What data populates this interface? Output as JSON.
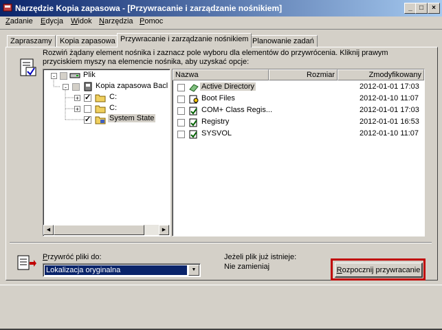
{
  "window": {
    "title": "Narzędzie Kopia zapasowa - [Przywracanie i zarządzanie nośnikiem]",
    "controls": [
      "_",
      "□",
      "×"
    ]
  },
  "menu": [
    {
      "label": "Zadanie",
      "accel": "Z",
      "rest": "adanie"
    },
    {
      "label": "Edycja",
      "accel": "E",
      "rest": "dycja"
    },
    {
      "label": "Widok",
      "accel": "W",
      "rest": "idok"
    },
    {
      "label": "Narzędzia",
      "accel": "N",
      "rest": "arzędzia"
    },
    {
      "label": "Pomoc",
      "accel": "P",
      "rest": "omoc"
    }
  ],
  "tabs": [
    "Zapraszamy",
    "Kopia zapasowa",
    "Przywracanie i zarządzanie nośnikiem",
    "Planowanie zadań"
  ],
  "instructions": "Rozwiń żądany element nośnika i zaznacz pole wyboru dla elementów do przywrócenia. Kliknij prawym przyciskiem myszy na elemencie nośnika, aby uzyskać opcje:",
  "tree": [
    {
      "label": "Plik",
      "check": "gray",
      "expander": "-"
    },
    {
      "label": "Kopia zapasowa Bacl",
      "check": "gray",
      "expander": "-"
    },
    {
      "label": "C:",
      "check": "checked",
      "expander": "+"
    },
    {
      "label": "C:",
      "check": "empty",
      "expander": "+"
    },
    {
      "label": "System State",
      "check": "checked",
      "expander": ""
    }
  ],
  "list": {
    "headers": {
      "name": "Nazwa",
      "size": "Rozmiar",
      "modified": "Zmodyfikowany"
    },
    "rows": [
      {
        "name": "Active Directory",
        "modified": "2012-01-01 17:03",
        "icon": "directory-icon"
      },
      {
        "name": "Boot Files",
        "modified": "2012-01-10 11:07",
        "icon": "boot-files-icon"
      },
      {
        "name": "COM+ Class Regis...",
        "modified": "2012-01-01 17:03",
        "icon": "com-class-icon"
      },
      {
        "name": "Registry",
        "modified": "2012-01-01 16:53",
        "icon": "registry-icon"
      },
      {
        "name": "SYSVOL",
        "modified": "2012-01-10 11:07",
        "icon": "sysvol-icon"
      }
    ]
  },
  "restore": {
    "label": "Przywróć pliki do:",
    "accel": "P",
    "rest": "rzywróć pliki do:",
    "selected": "Lokalizacja oryginalna"
  },
  "if_exists": {
    "label": "Jeżeli plik już istnieje:",
    "value": "Nie zamieniaj"
  },
  "start_button": {
    "label": "Rozpocznij przywracanie",
    "accel": "R",
    "rest": "ozpocznij przywracanie"
  },
  "colors": {
    "highlight": "#c00000",
    "selection": "#0a246a",
    "title_start": "#0a246a",
    "title_end": "#a6caf0"
  }
}
